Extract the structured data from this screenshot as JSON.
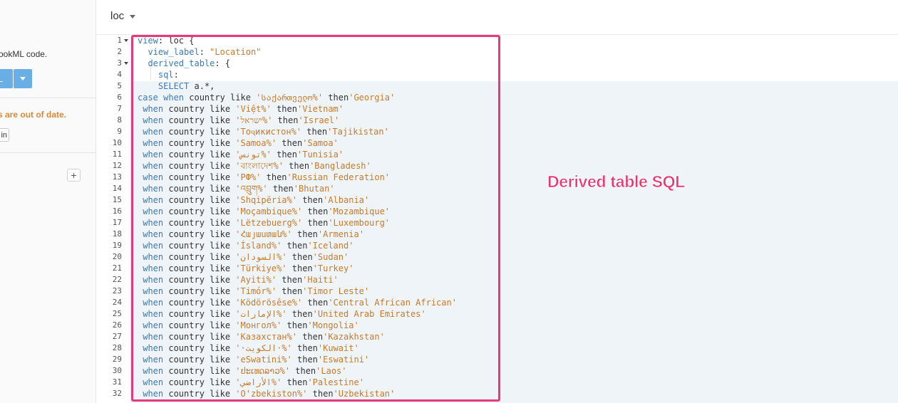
{
  "sidebar": {
    "text": "ookML code.",
    "warning": "s are out of date.",
    "small_btn_label": "in",
    "plus_label": "+"
  },
  "header": {
    "file_tab": "loc"
  },
  "editor": {
    "lines": [
      {
        "n": "1",
        "fold": true,
        "parts": [
          [
            "kw",
            "view"
          ],
          [
            "pl",
            ": loc {"
          ]
        ]
      },
      {
        "n": "2",
        "fold": false,
        "parts": [
          [
            "pl",
            "  "
          ],
          [
            "kw",
            "view_label"
          ],
          [
            "pl",
            ": "
          ],
          [
            "str",
            "\"Location\""
          ]
        ]
      },
      {
        "n": "3",
        "fold": true,
        "parts": [
          [
            "pl",
            "  "
          ],
          [
            "kw",
            "derived_table"
          ],
          [
            "pl",
            ": {"
          ]
        ]
      },
      {
        "n": "4",
        "fold": false,
        "parts": [
          [
            "pl",
            "    "
          ],
          [
            "kw",
            "sql"
          ],
          [
            "pl",
            ":"
          ]
        ]
      },
      {
        "n": "5",
        "fold": false,
        "parts": [
          [
            "pl",
            "    "
          ],
          [
            "kw",
            "SELECT"
          ],
          [
            "pl",
            " a.*,"
          ]
        ]
      },
      {
        "n": "6",
        "fold": false,
        "parts": [
          [
            "kw",
            "case when"
          ],
          [
            "pl",
            " country like "
          ],
          [
            "str",
            "'საქართველო%'"
          ],
          [
            "pl",
            " then"
          ],
          [
            "str",
            "'Georgia'"
          ]
        ]
      },
      {
        "n": "7",
        "fold": false,
        "parts": [
          [
            "kw",
            " when"
          ],
          [
            "pl",
            " country like "
          ],
          [
            "str",
            "'Việt%'"
          ],
          [
            "pl",
            " then"
          ],
          [
            "str",
            "'Vietnam'"
          ]
        ]
      },
      {
        "n": "8",
        "fold": false,
        "parts": [
          [
            "kw",
            " when"
          ],
          [
            "pl",
            " country like "
          ],
          [
            "str",
            "'ישראל%'"
          ],
          [
            "pl",
            " then"
          ],
          [
            "str",
            "'Israel'"
          ]
        ]
      },
      {
        "n": "9",
        "fold": false,
        "parts": [
          [
            "kw",
            " when"
          ],
          [
            "pl",
            " country like "
          ],
          [
            "str",
            "'Тоҷикистон%'"
          ],
          [
            "pl",
            " then"
          ],
          [
            "str",
            "'Tajikistan'"
          ]
        ]
      },
      {
        "n": "10",
        "fold": false,
        "parts": [
          [
            "kw",
            " when"
          ],
          [
            "pl",
            " country like "
          ],
          [
            "str",
            "'Samoa%'"
          ],
          [
            "pl",
            " then"
          ],
          [
            "str",
            "'Samoa'"
          ]
        ]
      },
      {
        "n": "11",
        "fold": false,
        "parts": [
          [
            "kw",
            " when"
          ],
          [
            "pl",
            " country like "
          ],
          [
            "str",
            "'تونس%'"
          ],
          [
            "pl",
            " then"
          ],
          [
            "str",
            "'Tunisia'"
          ]
        ]
      },
      {
        "n": "12",
        "fold": false,
        "parts": [
          [
            "kw",
            " when"
          ],
          [
            "pl",
            " country like "
          ],
          [
            "str",
            "'বাংলাদেশ%'"
          ],
          [
            "pl",
            " then"
          ],
          [
            "str",
            "'Bangladesh'"
          ]
        ]
      },
      {
        "n": "13",
        "fold": false,
        "parts": [
          [
            "kw",
            " when"
          ],
          [
            "pl",
            " country like "
          ],
          [
            "str",
            "'РФ%'"
          ],
          [
            "pl",
            " then"
          ],
          [
            "str",
            "'Russian Federation'"
          ]
        ]
      },
      {
        "n": "14",
        "fold": false,
        "parts": [
          [
            "kw",
            " when"
          ],
          [
            "pl",
            " country like "
          ],
          [
            "str",
            "'འབྲུག%'"
          ],
          [
            "pl",
            " then"
          ],
          [
            "str",
            "'Bhutan'"
          ]
        ]
      },
      {
        "n": "15",
        "fold": false,
        "parts": [
          [
            "kw",
            " when"
          ],
          [
            "pl",
            " country like "
          ],
          [
            "str",
            "'Shqipëria%'"
          ],
          [
            "pl",
            " then"
          ],
          [
            "str",
            "'Albania'"
          ]
        ]
      },
      {
        "n": "16",
        "fold": false,
        "parts": [
          [
            "kw",
            " when"
          ],
          [
            "pl",
            " country like "
          ],
          [
            "str",
            "'Moçambique%'"
          ],
          [
            "pl",
            " then"
          ],
          [
            "str",
            "'Mozambique'"
          ]
        ]
      },
      {
        "n": "17",
        "fold": false,
        "parts": [
          [
            "kw",
            " when"
          ],
          [
            "pl",
            " country like "
          ],
          [
            "str",
            "'Lëtzebuerg%'"
          ],
          [
            "pl",
            " then"
          ],
          [
            "str",
            "'Luxembourg'"
          ]
        ]
      },
      {
        "n": "18",
        "fold": false,
        "parts": [
          [
            "kw",
            " when"
          ],
          [
            "pl",
            " country like "
          ],
          [
            "str",
            "'Հայաստան%'"
          ],
          [
            "pl",
            " then"
          ],
          [
            "str",
            "'Armenia'"
          ]
        ]
      },
      {
        "n": "19",
        "fold": false,
        "parts": [
          [
            "kw",
            " when"
          ],
          [
            "pl",
            " country like "
          ],
          [
            "str",
            "'Ísland%'"
          ],
          [
            "pl",
            " then"
          ],
          [
            "str",
            "'Iceland'"
          ]
        ]
      },
      {
        "n": "20",
        "fold": false,
        "parts": [
          [
            "kw",
            " when"
          ],
          [
            "pl",
            " country like "
          ],
          [
            "str",
            "'السودان%'"
          ],
          [
            "pl",
            " then"
          ],
          [
            "str",
            "'Sudan'"
          ]
        ]
      },
      {
        "n": "21",
        "fold": false,
        "parts": [
          [
            "kw",
            " when"
          ],
          [
            "pl",
            " country like "
          ],
          [
            "str",
            "'Türkiye%'"
          ],
          [
            "pl",
            " then"
          ],
          [
            "str",
            "'Turkey'"
          ]
        ]
      },
      {
        "n": "22",
        "fold": false,
        "parts": [
          [
            "kw",
            " when"
          ],
          [
            "pl",
            " country like "
          ],
          [
            "str",
            "'Ayiti%'"
          ],
          [
            "pl",
            " then"
          ],
          [
            "str",
            "'Haiti'"
          ]
        ]
      },
      {
        "n": "23",
        "fold": false,
        "parts": [
          [
            "kw",
            " when"
          ],
          [
            "pl",
            " country like "
          ],
          [
            "str",
            "'Timór%'"
          ],
          [
            "pl",
            " then"
          ],
          [
            "str",
            "'Timor Leste'"
          ]
        ]
      },
      {
        "n": "24",
        "fold": false,
        "parts": [
          [
            "kw",
            " when"
          ],
          [
            "pl",
            " country like "
          ],
          [
            "str",
            "'Ködörösêse%'"
          ],
          [
            "pl",
            " then"
          ],
          [
            "str",
            "'Central African African'"
          ]
        ]
      },
      {
        "n": "25",
        "fold": false,
        "parts": [
          [
            "kw",
            " when"
          ],
          [
            "pl",
            " country like "
          ],
          [
            "str",
            "'الإمارات%'"
          ],
          [
            "pl",
            " then"
          ],
          [
            "str",
            "'United Arab Emirates'"
          ]
        ]
      },
      {
        "n": "26",
        "fold": false,
        "parts": [
          [
            "kw",
            " when"
          ],
          [
            "pl",
            " country like "
          ],
          [
            "str",
            "'Монгол%'"
          ],
          [
            "pl",
            " then"
          ],
          [
            "str",
            "'Mongolia'"
          ]
        ]
      },
      {
        "n": "27",
        "fold": false,
        "parts": [
          [
            "kw",
            " when"
          ],
          [
            "pl",
            " country like "
          ],
          [
            "str",
            "'Казахстан%'"
          ],
          [
            "pl",
            " then"
          ],
          [
            "str",
            "'Kazakhstan'"
          ]
        ]
      },
      {
        "n": "28",
        "fold": false,
        "parts": [
          [
            "kw",
            " when"
          ],
          [
            "pl",
            " country like "
          ],
          [
            "str",
            "'·الكويت·%'"
          ],
          [
            "pl",
            " then"
          ],
          [
            "str",
            "'Kuwait'"
          ]
        ]
      },
      {
        "n": "29",
        "fold": false,
        "parts": [
          [
            "kw",
            " when"
          ],
          [
            "pl",
            " country like "
          ],
          [
            "str",
            "'eSwatini%'"
          ],
          [
            "pl",
            " then"
          ],
          [
            "str",
            "'Eswatini'"
          ]
        ]
      },
      {
        "n": "30",
        "fold": false,
        "parts": [
          [
            "kw",
            " when"
          ],
          [
            "pl",
            " country like "
          ],
          [
            "str",
            "'ປະເທດລາວ%'"
          ],
          [
            "pl",
            " then"
          ],
          [
            "str",
            "'Laos'"
          ]
        ]
      },
      {
        "n": "31",
        "fold": false,
        "parts": [
          [
            "kw",
            " when"
          ],
          [
            "pl",
            " country like "
          ],
          [
            "str",
            "'الأراضي%'"
          ],
          [
            "pl",
            " then"
          ],
          [
            "str",
            "'Palestine'"
          ]
        ]
      },
      {
        "n": "32",
        "fold": false,
        "parts": [
          [
            "kw",
            " when"
          ],
          [
            "pl",
            " country like "
          ],
          [
            "str",
            "'O'zbekiston%'"
          ],
          [
            "pl",
            " then"
          ],
          [
            "str",
            "'Uzbekistan'"
          ]
        ]
      }
    ]
  },
  "annotation": {
    "label": "Derived table SQL",
    "color": "#e63a7a"
  }
}
